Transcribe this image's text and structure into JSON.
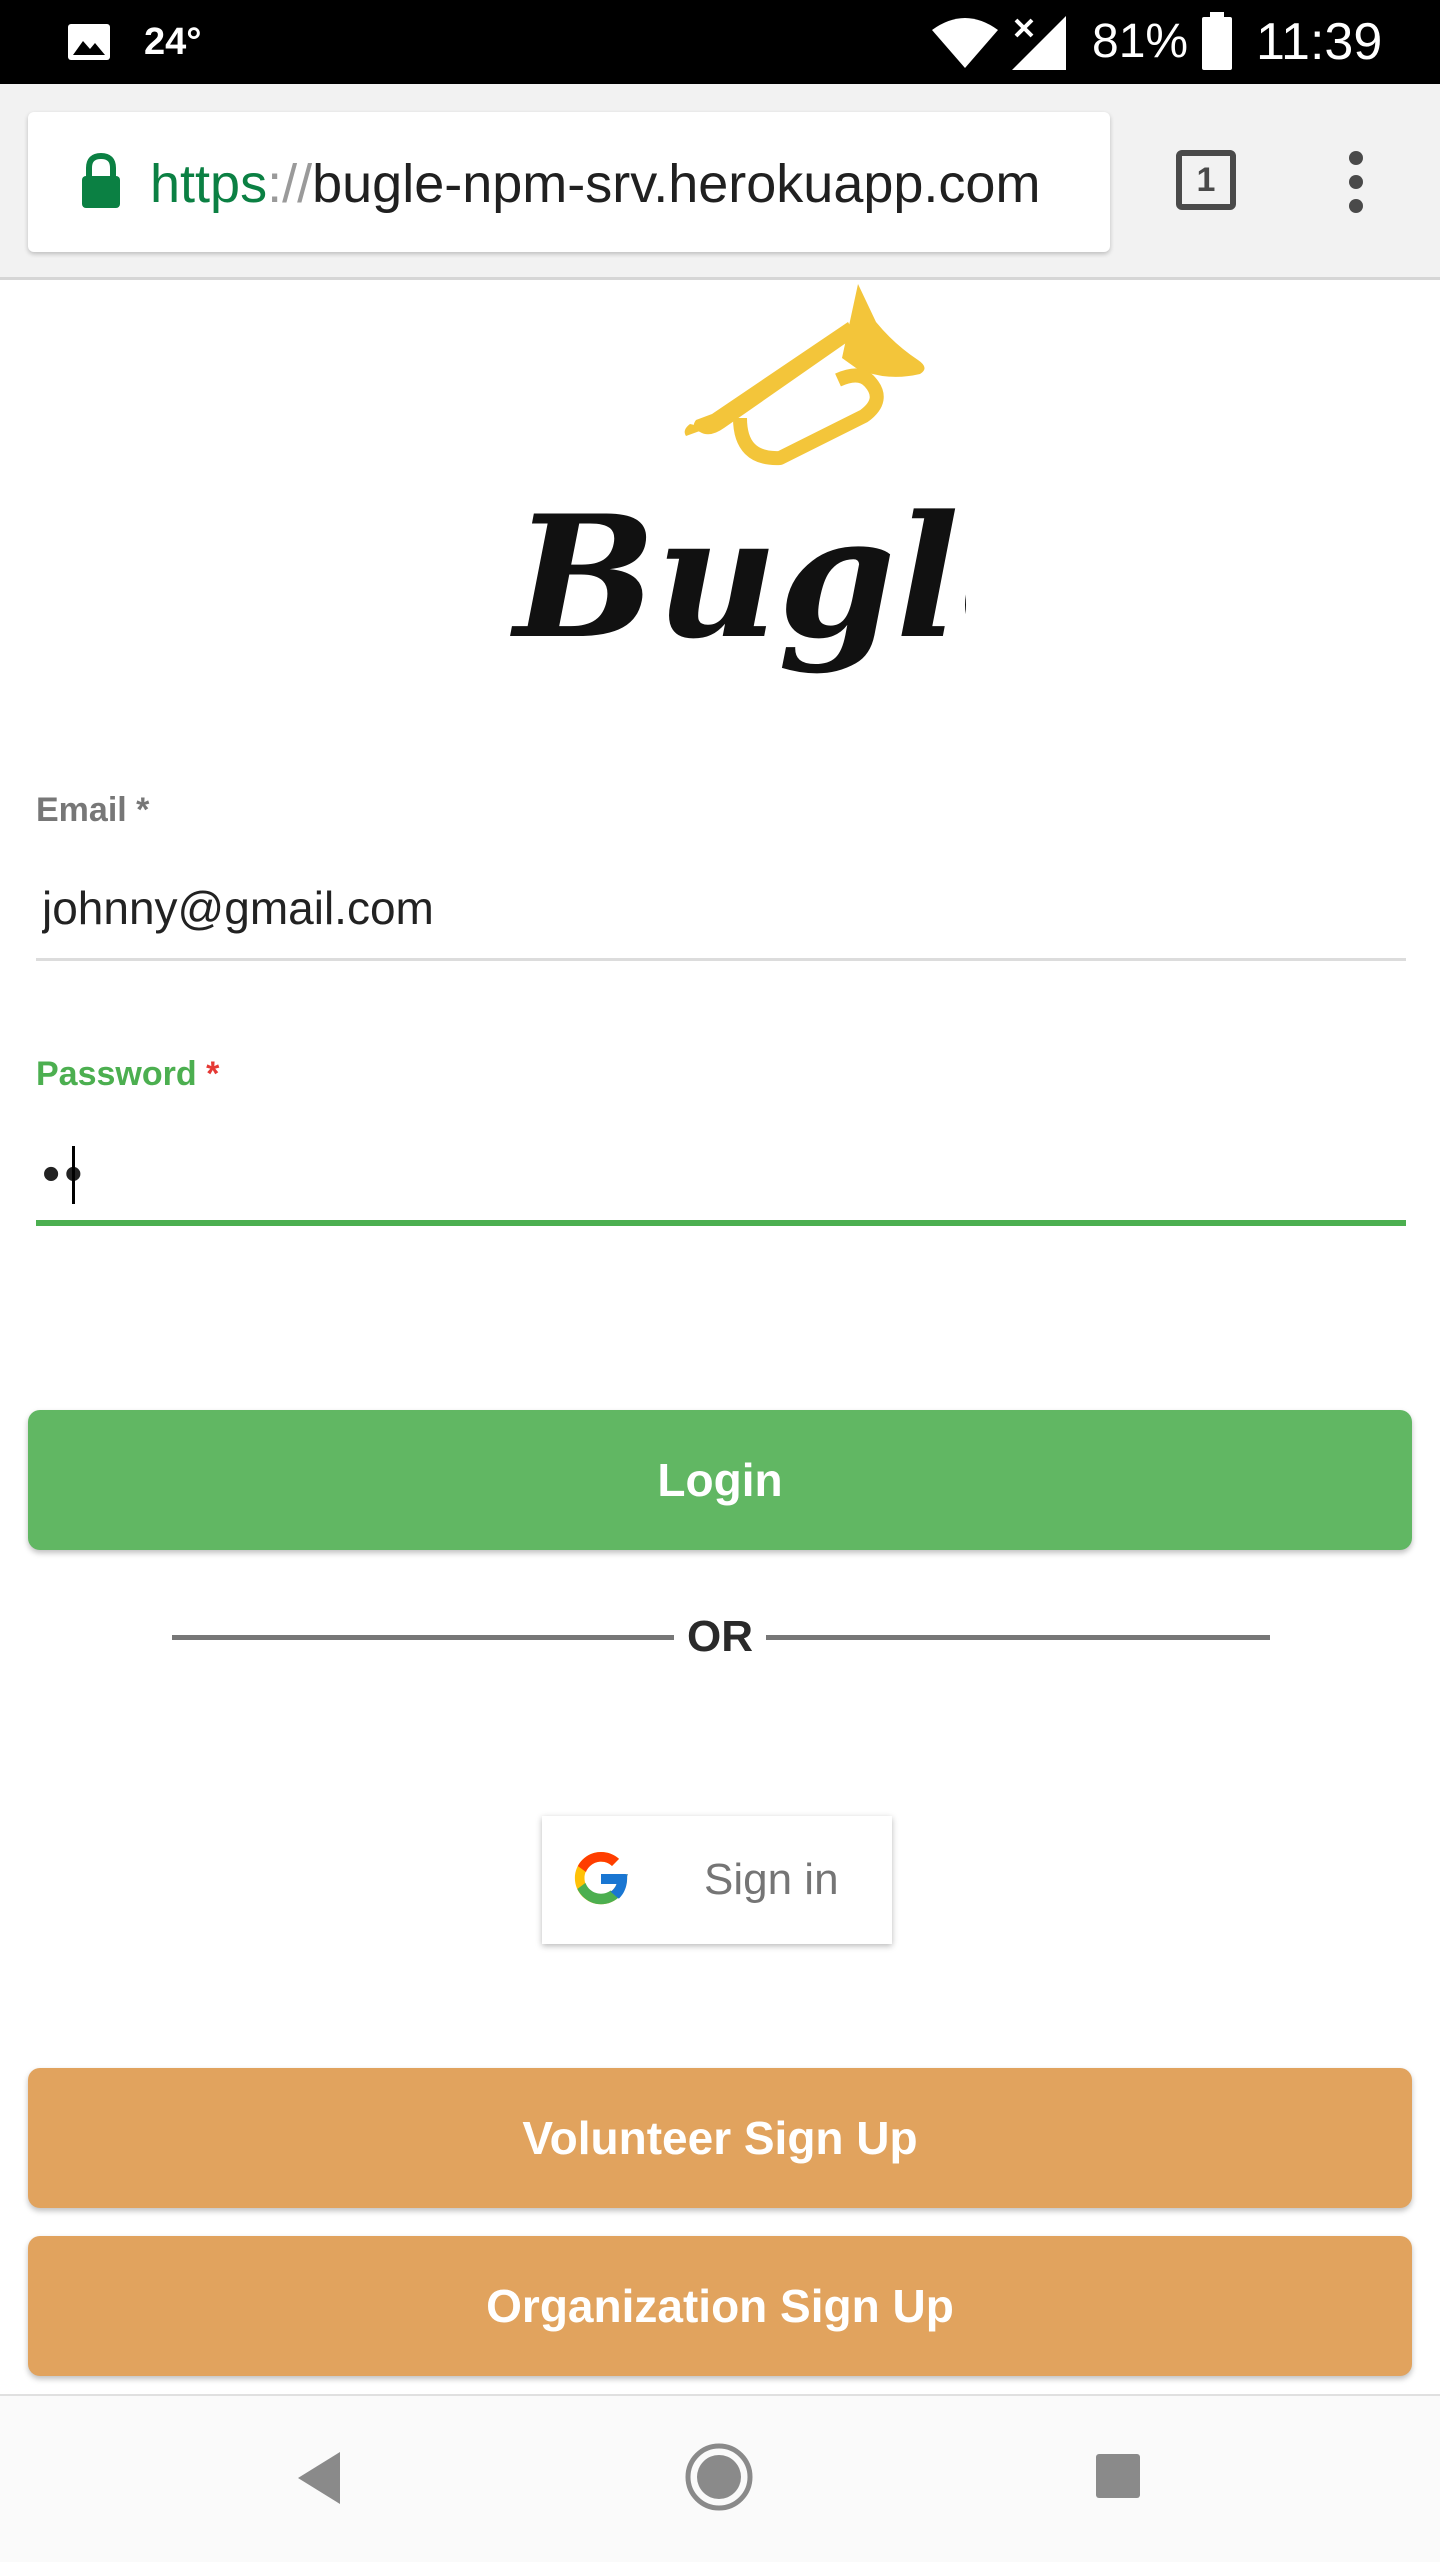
{
  "status_bar": {
    "temperature": "24°",
    "battery": "81%",
    "time": "11:39"
  },
  "browser": {
    "url_scheme": "https",
    "url_separator": "://",
    "url_host": "bugle-npm-srv.herokuapp.com",
    "tab_count": "1"
  },
  "brand": {
    "logo_wordmark": "Bugle",
    "logo_color": "#f3c53a"
  },
  "form": {
    "email_label": "Email",
    "email_required_marker": " *",
    "email_value": "johnny@gmail.com",
    "password_label": "Password",
    "password_required_marker": " *",
    "password_value": "••"
  },
  "actions": {
    "login_label": "Login",
    "or_text": "OR",
    "google_signin_label": "Sign in",
    "volunteer_signup_label": "Volunteer Sign Up",
    "org_signup_label": "Organization Sign Up"
  },
  "colors": {
    "login_green": "#61b763",
    "signup_orange": "#e1a35e",
    "focus_green": "#4caf50",
    "url_secure_green": "#0b8043",
    "required_red": "#e53935"
  },
  "icons": {
    "status": [
      "gallery-icon",
      "wifi-icon",
      "signal-icon",
      "battery-icon"
    ],
    "toolbar": [
      "lock-icon",
      "tabs-icon",
      "overflow-menu-icon"
    ],
    "navigation": [
      "back-icon",
      "home-icon",
      "recents-icon"
    ]
  }
}
